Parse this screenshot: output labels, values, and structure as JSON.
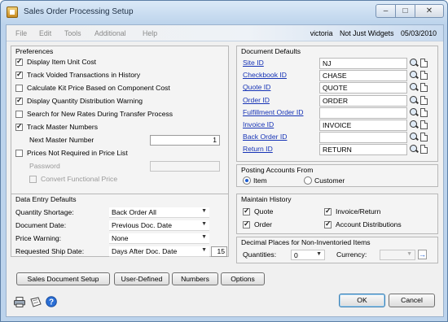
{
  "window": {
    "title": "Sales Order Processing Setup",
    "min": "–",
    "max": "□",
    "close": "✕"
  },
  "menu": {
    "items": [
      "File",
      "Edit",
      "Tools",
      "Additional",
      "Help"
    ],
    "user": "victoria",
    "company": "Not Just Widgets",
    "date": "05/03/2010"
  },
  "preferences": {
    "title": "Preferences",
    "display_unit_cost": {
      "label": "Display Item Unit Cost",
      "checked": true
    },
    "track_voided": {
      "label": "Track Voided Transactions in History",
      "checked": true
    },
    "calc_kit_price": {
      "label": "Calculate Kit Price Based on Component Cost",
      "checked": false
    },
    "display_qty_dist": {
      "label": "Display Quantity Distribution Warning",
      "checked": true
    },
    "search_new_rates": {
      "label": "Search for New Rates During Transfer Process",
      "checked": false
    },
    "track_master": {
      "label": "Track Master Numbers",
      "checked": true
    },
    "next_master_label": "Next Master Number",
    "next_master_value": "1",
    "prices_not_required": {
      "label": "Prices Not Required in Price List",
      "checked": false
    },
    "password_label": "Password",
    "password_value": "",
    "convert_functional": {
      "label": "Convert Functional Price",
      "checked": false,
      "disabled": true
    }
  },
  "data_entry": {
    "title": "Data Entry Defaults",
    "quantity_shortage": {
      "label": "Quantity Shortage:",
      "value": "Back Order All"
    },
    "document_date": {
      "label": "Document Date:",
      "value": "Previous Doc. Date"
    },
    "price_warning": {
      "label": "Price Warning:",
      "value": "None"
    },
    "requested_ship_date": {
      "label": "Requested Ship Date:",
      "value": "Days After Doc. Date",
      "days": "15"
    }
  },
  "document_defaults": {
    "title": "Document Defaults",
    "rows": [
      {
        "label": "Site ID",
        "value": "NJ"
      },
      {
        "label": "Checkbook ID",
        "value": "CHASE"
      },
      {
        "label": "Quote ID",
        "value": "QUOTE"
      },
      {
        "label": "Order ID",
        "value": "ORDER"
      },
      {
        "label": "Fulfillment Order ID",
        "value": ""
      },
      {
        "label": "Invoice ID",
        "value": "INVOICE"
      },
      {
        "label": "Back Order ID",
        "value": ""
      },
      {
        "label": "Return ID",
        "value": "RETURN"
      }
    ]
  },
  "posting_accounts": {
    "title": "Posting Accounts From",
    "item_label": "Item",
    "customer_label": "Customer",
    "selected": "Item"
  },
  "maintain_history": {
    "title": "Maintain History",
    "quote": {
      "label": "Quote",
      "checked": true
    },
    "order": {
      "label": "Order",
      "checked": true
    },
    "invoice_return": {
      "label": "Invoice/Return",
      "checked": true
    },
    "account_dist": {
      "label": "Account Distributions",
      "checked": true
    }
  },
  "decimal_places": {
    "title": "Decimal Places for Non-Inventoried Items",
    "quantities_label": "Quantities:",
    "quantities_value": "0",
    "currency_label": "Currency:",
    "currency_value": ""
  },
  "buttons": {
    "sales_doc_setup": "Sales Document Setup",
    "user_defined": "User-Defined",
    "numbers": "Numbers",
    "options": "Options",
    "ok": "OK",
    "cancel": "Cancel"
  },
  "colors": {
    "link": "#1633b6",
    "accent": "#1a5bd0",
    "titlebar": "#bcd3ec"
  }
}
